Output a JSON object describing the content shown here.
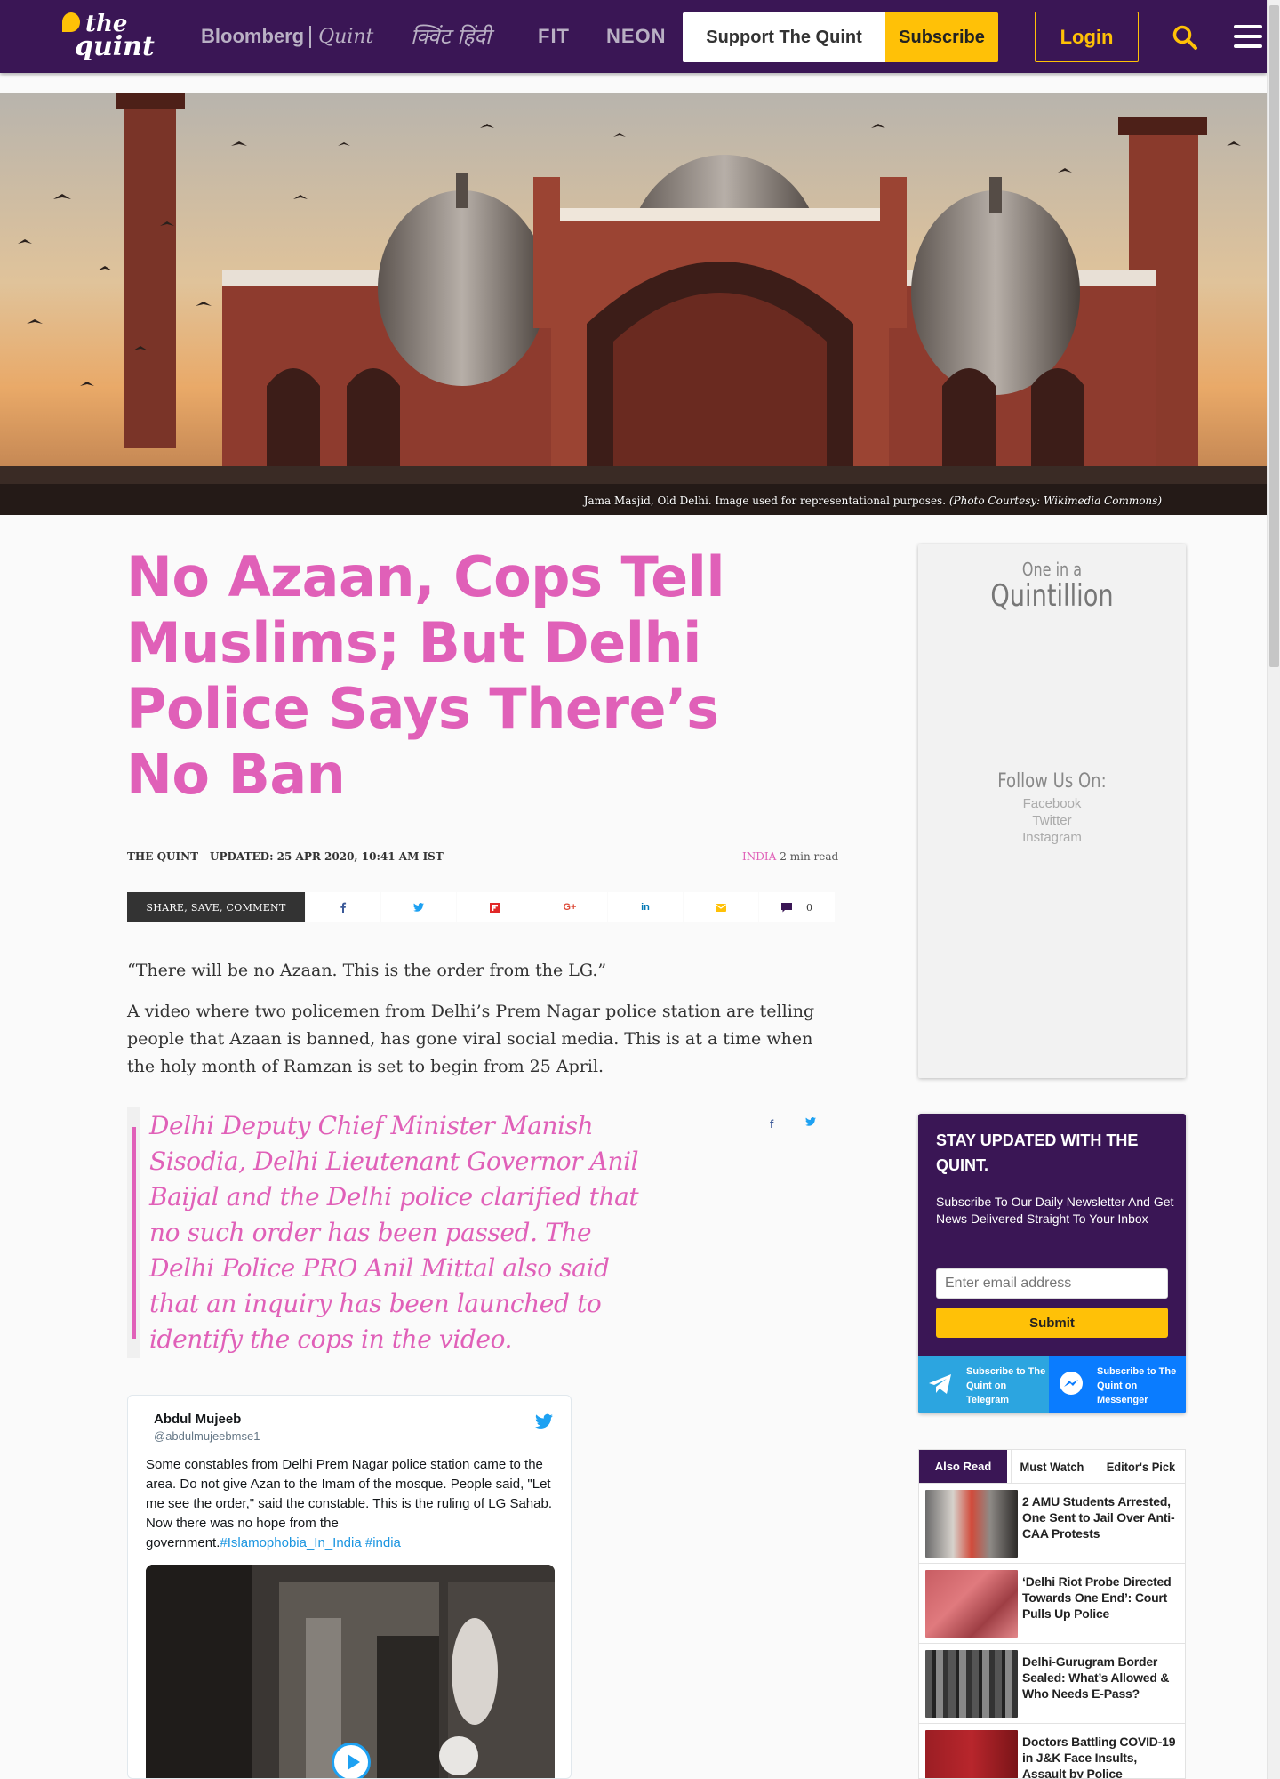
{
  "header": {
    "logo_line1": "the",
    "logo_line2": "quint",
    "partners": {
      "bloomberg": "Bloomberg",
      "quint": "Quint",
      "hindi": "क्विंट हिंदी",
      "fit": "FIT",
      "neon": "NEON"
    },
    "support_label": "Support The Quint",
    "subscribe_label": "Subscribe",
    "login_label": "Login",
    "brand_color": "#3a1655",
    "accent_color": "#ffc107"
  },
  "hero": {
    "caption": "Jama Masjid, Old Delhi. Image used for representational purposes.",
    "credit": "(Photo Courtesy: Wikimedia Commons)"
  },
  "article": {
    "title": "No Azaan, Cops Tell Muslims; But Delhi Police Says There’s No Ban",
    "byline": "THE QUINT",
    "updated": "UPDATED: 25 APR 2020, 10:41 AM IST",
    "category": "INDIA",
    "read_time": "2 min read",
    "title_color": "#e060b8",
    "share": {
      "label": "SHARE, SAVE, COMMENT",
      "comment_count": "0",
      "icons": [
        "facebook-icon",
        "twitter-icon",
        "flipboard-icon",
        "google-plus-icon",
        "linkedin-icon",
        "email-icon",
        "comment-icon"
      ]
    },
    "para1": "“There will be no Azaan. This is the order from the LG.”",
    "para2": "A video where two policemen from Delhi’s Prem Nagar police station are telling people that Azaan is banned, has gone viral social media. This is at a time when the holy month of Ramzan is set to begin from 25 April.",
    "pullquote": "Delhi Deputy Chief Minister Manish Sisodia, Delhi Lieutenant Governor Anil Baijal and the Delhi police clarified that no such order has been passed. The Delhi Police PRO Anil Mittal also said that an inquiry has been launched to identify the cops in the video."
  },
  "tweet": {
    "name": "Abdul Mujeeb",
    "handle": "@abdulmujeebmse1",
    "text": "Some constables from Delhi Prem Nagar police station came to the area. Do not give Azan to the Imam of the mosque. People said, \"Let me see the order,\" said the constable. This is the ruling of LG Sahab. Now there was no hope from the government.",
    "hashtags": "#Islamophobia_In_India #india"
  },
  "sidebar": {
    "promo": {
      "line1": "One in a",
      "line2": "Quintillion",
      "follow": "Follow Us On:",
      "links": [
        "Facebook",
        "Twitter",
        "Instagram"
      ]
    },
    "newsletter": {
      "title": "STAY UPDATED WITH THE QUINT.",
      "subtitle": "Subscribe To Our Daily Newsletter And Get News Delivered Straight To Your Inbox",
      "email_placeholder": "Enter email address",
      "submit_label": "Submit",
      "telegram_label": "Subscribe to The Quint on Telegram",
      "messenger_label": "Subscribe to The Quint on Messenger"
    },
    "tabs": [
      "Also Read",
      "Must Watch",
      "Editor's Pick"
    ],
    "news": [
      {
        "title": "2 AMU Students Arrested, One Sent to Jail Over Anti-CAA Protests"
      },
      {
        "title": "‘Delhi Riot Probe Directed Towards One End’: Court Pulls Up Police"
      },
      {
        "title": "Delhi-Gurugram Border Sealed: What’s Allowed & Who Needs E-Pass?"
      },
      {
        "title": "Doctors Battling COVID-19 in J&K Face Insults, Assault by Police"
      }
    ]
  }
}
